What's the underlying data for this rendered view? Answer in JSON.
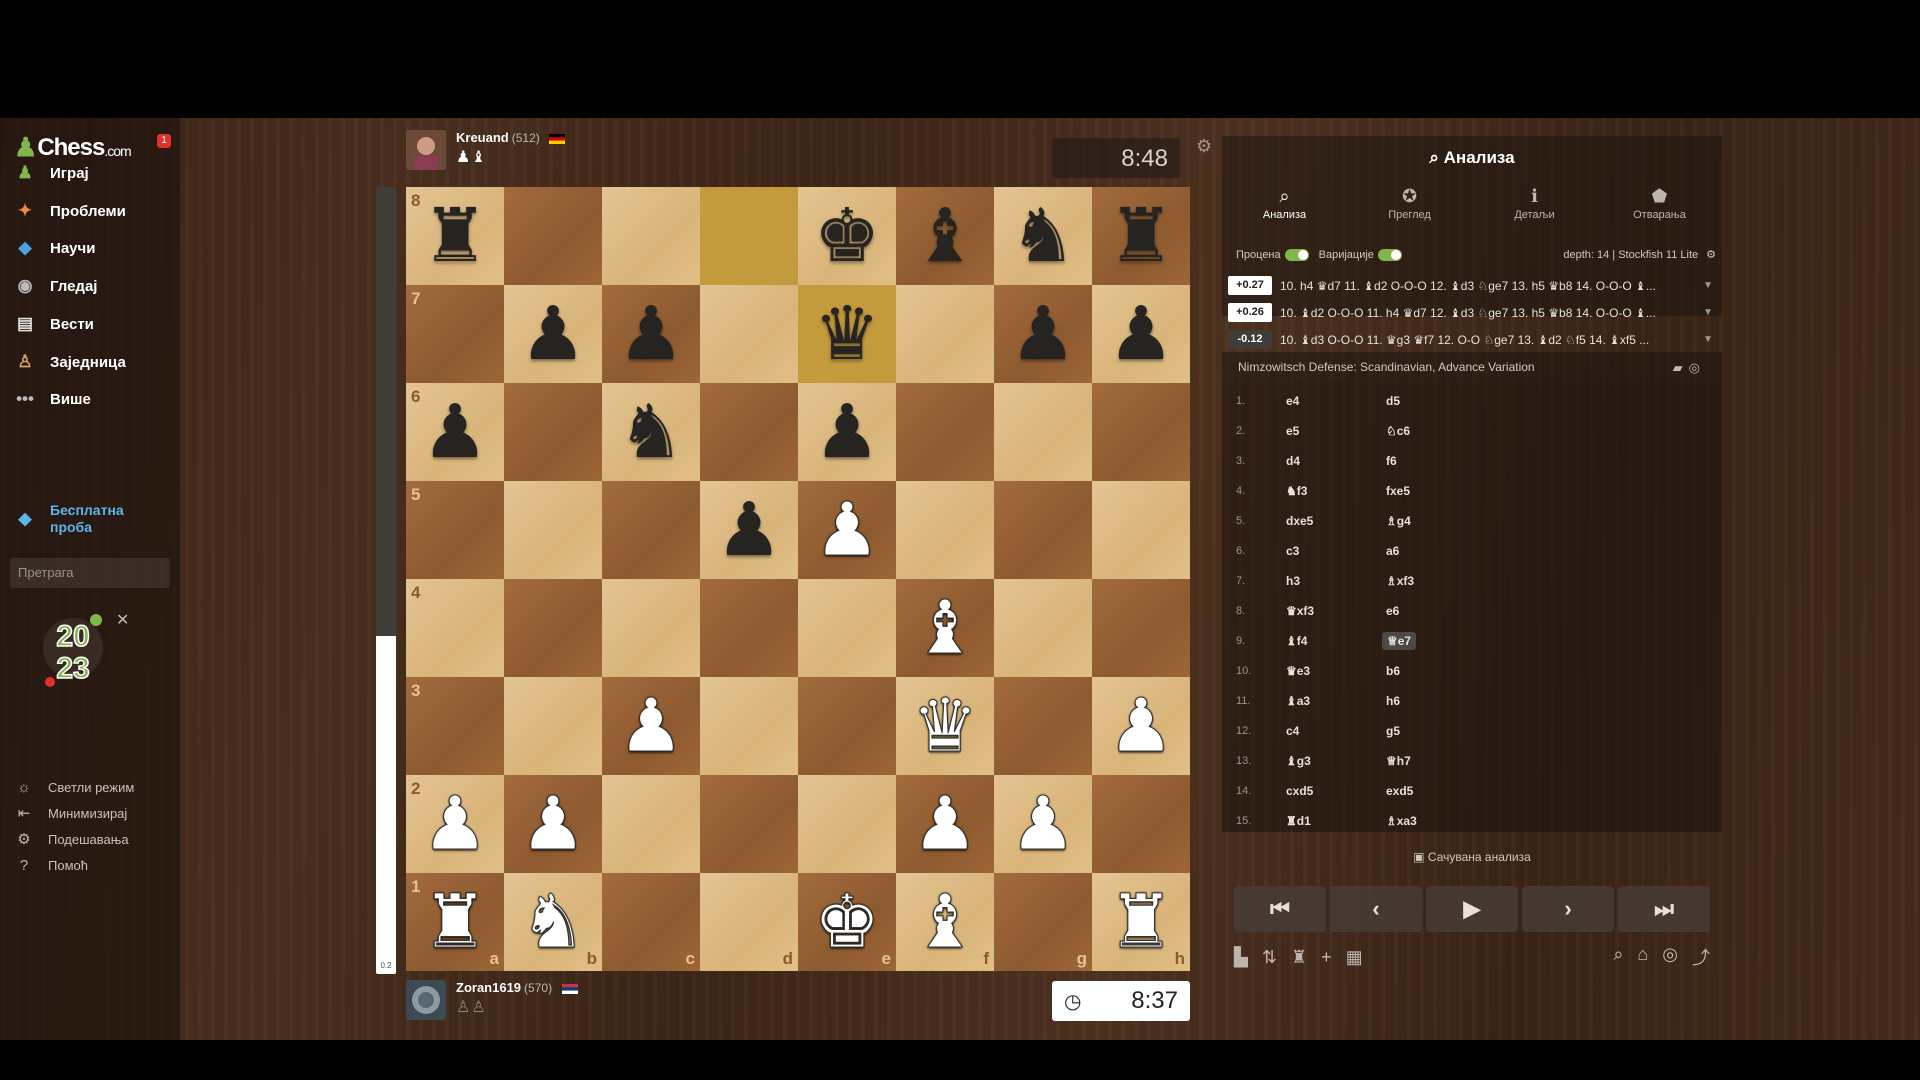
{
  "sidebar": {
    "logo": "Chess",
    "logo_suffix": ".com",
    "notification_count": "1",
    "nav": [
      {
        "label": "Играј",
        "icon": "pawn-icon",
        "glyph": "♟",
        "color": "#81b64c"
      },
      {
        "label": "Проблеми",
        "icon": "puzzle-icon",
        "glyph": "✦",
        "color": "#f28a3c"
      },
      {
        "label": "Научи",
        "icon": "graduation-icon",
        "glyph": "◆",
        "color": "#4aa3df"
      },
      {
        "label": "Гледај",
        "icon": "binoculars-icon",
        "glyph": "◉",
        "color": "#bbbbbb"
      },
      {
        "label": "Вести",
        "icon": "news-icon",
        "glyph": "▤",
        "color": "#e0e0e0"
      },
      {
        "label": "Заједница",
        "icon": "people-icon",
        "glyph": "♙",
        "color": "#d9a66b"
      },
      {
        "label": "Више",
        "icon": "more-icon",
        "glyph": "•••",
        "color": "#bbbbbb"
      }
    ],
    "trial_label": "Бесплатна проба",
    "search_placeholder": "Претрага",
    "badge_year_top": "20",
    "badge_year_bottom": "23",
    "bottom": [
      {
        "label": "Светли режим",
        "icon": "sun-icon",
        "glyph": "☼"
      },
      {
        "label": "Минимизирај",
        "icon": "collapse-icon",
        "glyph": "⇤"
      },
      {
        "label": "Подешавања",
        "icon": "gear-icon",
        "glyph": "⚙"
      },
      {
        "label": "Помоћ",
        "icon": "help-icon",
        "glyph": "?"
      }
    ]
  },
  "top_player": {
    "name": "Kreuand",
    "rating": "(512)",
    "captured": "♟♝",
    "clock": "8:48"
  },
  "bottom_player": {
    "name": "Zoran1619",
    "rating": "(570)",
    "captured": "♙♙",
    "clock": "8:37"
  },
  "eval_bar": {
    "label": "0.2",
    "white_fraction": 0.43
  },
  "board": {
    "files": [
      "a",
      "b",
      "c",
      "d",
      "e",
      "f",
      "g",
      "h"
    ],
    "ranks": [
      "8",
      "7",
      "6",
      "5",
      "4",
      "3",
      "2",
      "1"
    ],
    "highlighted": [
      "d8",
      "e7"
    ],
    "position": [
      [
        "br",
        "",
        "",
        "",
        "bk",
        "bb",
        "bn",
        "br"
      ],
      [
        "",
        "bp",
        "bp",
        "",
        "bq",
        "",
        "bp",
        "bp"
      ],
      [
        "bp",
        "",
        "bn",
        "",
        "bp",
        "",
        "",
        ""
      ],
      [
        "",
        "",
        "",
        "bp",
        "wp",
        "",
        "",
        ""
      ],
      [
        "",
        "",
        "",
        "",
        "",
        "wb",
        "",
        ""
      ],
      [
        "",
        "",
        "wp",
        "",
        "",
        "wq",
        "",
        "wp"
      ],
      [
        "wp",
        "wp",
        "",
        "",
        "",
        "wp",
        "wp",
        ""
      ],
      [
        "wr",
        "wn",
        "",
        "",
        "wk",
        "wb",
        "",
        "wr"
      ]
    ]
  },
  "analysis": {
    "title": "Анализа",
    "tabs": [
      {
        "label": "Анализа",
        "icon": "magnifier-icon",
        "glyph": "⌕"
      },
      {
        "label": "Преглед",
        "icon": "star-icon",
        "glyph": "✪"
      },
      {
        "label": "Детаљи",
        "icon": "info-icon",
        "glyph": "ℹ"
      },
      {
        "label": "Отварања",
        "icon": "book-icon",
        "glyph": "⬟"
      }
    ],
    "eval_toggle_label": "Процена",
    "variations_toggle_label": "Варијације",
    "engine_info": "depth: 14 | Stockfish 11 Lite",
    "lines": [
      {
        "score": "+0.27",
        "moves": "10. h4 ♛d7 11. ♝d2 O-O-O 12. ♝d3 ♘ge7 13. h5 ♛b8 14. O-O-O ♝..."
      },
      {
        "score": "+0.26",
        "moves": "10. ♝d2 O-O-O 11. h4 ♛d7 12. ♝d3 ♘ge7 13. h5 ♛b8 14. O-O-O ♝..."
      },
      {
        "score": "-0.12",
        "moves": "10. ♝d3 O-O-O 11. ♛g3 ♛f7 12. O-O ♘ge7 13. ♝d2 ♘f5 14. ♝xf5 ..."
      }
    ],
    "opening": "Nimzowitsch Defense: Scandinavian, Advance Variation",
    "moves": [
      {
        "n": "1.",
        "w": "e4",
        "b": "d5"
      },
      {
        "n": "2.",
        "w": "e5",
        "b": "♘c6"
      },
      {
        "n": "3.",
        "w": "d4",
        "b": "f6"
      },
      {
        "n": "4.",
        "w": "♞f3",
        "b": "fxe5"
      },
      {
        "n": "5.",
        "w": "dxe5",
        "b": "♗g4"
      },
      {
        "n": "6.",
        "w": "c3",
        "b": "a6"
      },
      {
        "n": "7.",
        "w": "h3",
        "b": "♗xf3"
      },
      {
        "n": "8.",
        "w": "♛xf3",
        "b": "e6"
      },
      {
        "n": "9.",
        "w": "♝f4",
        "b": "♕e7"
      },
      {
        "n": "10.",
        "w": "♛e3",
        "b": "b6"
      },
      {
        "n": "11.",
        "w": "♝a3",
        "b": "h6"
      },
      {
        "n": "12.",
        "w": "c4",
        "b": "g5"
      },
      {
        "n": "13.",
        "w": "♝g3",
        "b": "♕h7"
      },
      {
        "n": "14.",
        "w": "cxd5",
        "b": "exd5"
      },
      {
        "n": "15.",
        "w": "♜d1",
        "b": "♗xa3"
      }
    ],
    "selected_move": "♕e7",
    "saved_label": "Сачувана анализа",
    "nav_buttons": [
      {
        "name": "first-move-button",
        "glyph": "⏮"
      },
      {
        "name": "prev-move-button",
        "glyph": "‹"
      },
      {
        "name": "play-button",
        "glyph": "▶"
      },
      {
        "name": "next-move-button",
        "glyph": "›"
      },
      {
        "name": "last-move-button",
        "glyph": "⏭"
      }
    ]
  }
}
